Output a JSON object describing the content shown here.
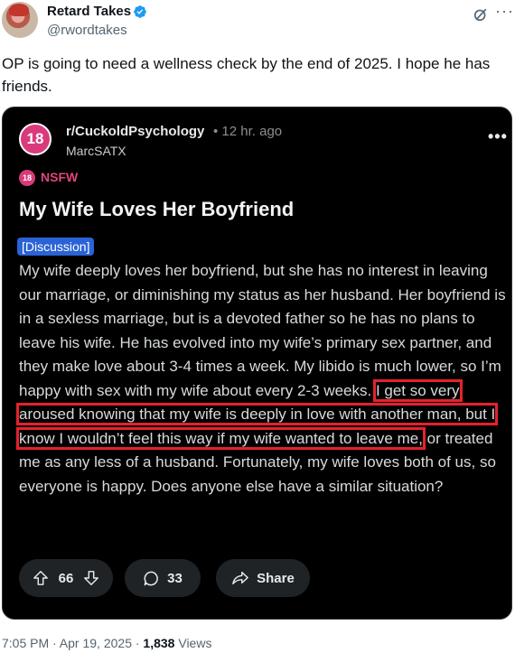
{
  "tweet": {
    "display_name": "Retard Takes",
    "handle": "@rwordtakes",
    "text": "OP is going to need a wellness check by the end of 2025.  I hope he has friends.",
    "timestamp": "7:05 PM · Apr 19, 2025 · ",
    "views_count": "1,838",
    "views_label": " Views"
  },
  "post": {
    "subreddit_badge": "18",
    "subreddit": "r/CuckoldPsychology",
    "time_ago": "• 12 hr. ago",
    "username": "MarcSATX",
    "nsfw_badge": "18",
    "nsfw_label": "NSFW",
    "title": "My Wife Loves Her Boyfriend",
    "flair": "[Discussion]",
    "body_before": "My wife deeply loves her boyfriend, but she has no interest in leaving our marriage, or diminishing my status as her husband. Her boyfriend is in a sexless marriage, but is a devoted father so he has no plans to leave his wife. He has evolved into my wife’s primary sex partner, and they make love about 3-4 times a week. My libido is much lower, so I’m happy with sex with my wife about every 2-3 weeks. ",
    "body_highlight": "I get so very aroused knowing that my wife is deeply in love with another man, but I know I wouldn’t feel this way if my wife wanted to leave me,",
    "body_after": " or treated me as any less of a husband. Fortunately, my wife loves both of us, so everyone is happy. Does anyone else have a similar situation?",
    "upvotes": "66",
    "comments": "33",
    "share_label": "Share"
  },
  "colors": {
    "nsfw_pink": "#d93a7b",
    "highlight_red": "#e6212e",
    "flair_blue": "#2b63d6",
    "verified_blue": "#1d9bf0"
  }
}
